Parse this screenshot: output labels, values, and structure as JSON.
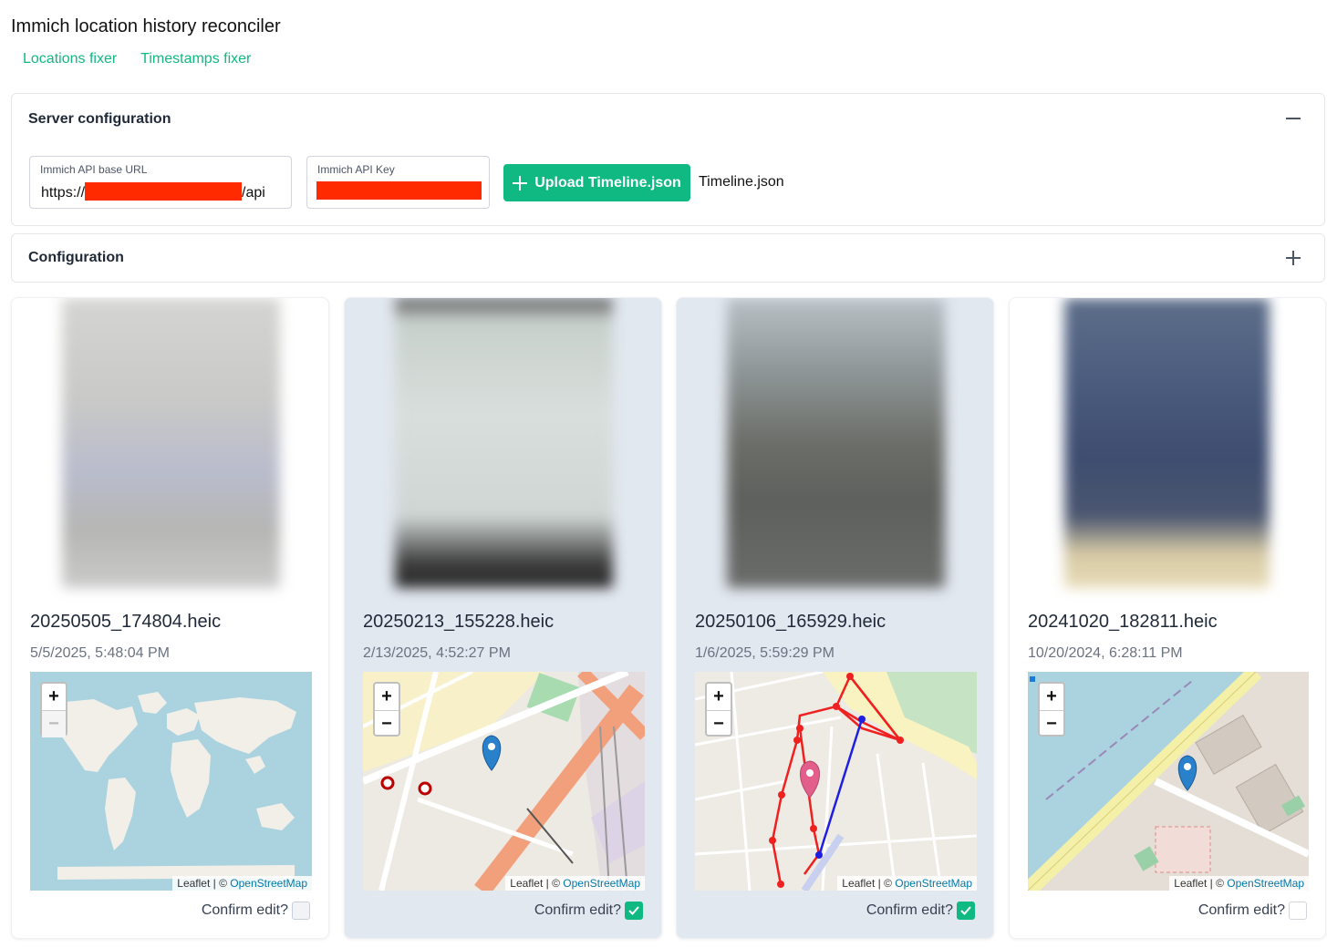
{
  "app": {
    "title": "Immich location history reconciler",
    "nav": [
      "Locations fixer",
      "Timestamps fixer"
    ]
  },
  "server_config": {
    "title": "Server configuration",
    "expanded": true,
    "api_url": {
      "label": "Immich API base URL",
      "prefix": "https://",
      "suffix": "/api"
    },
    "api_key": {
      "label": "Immich API Key"
    },
    "upload_label": "Upload Timeline.json",
    "uploaded_file": "Timeline.json"
  },
  "configuration": {
    "title": "Configuration",
    "expanded": false
  },
  "colors": {
    "accent": "#10b981",
    "redaction": "#ff2a00",
    "selected_card": "#e2e8f0",
    "route_red": "#ef2020",
    "route_blue": "#1f1fe0"
  },
  "cards": [
    {
      "filename": "20250505_174804.heic",
      "timestamp": "5/5/2025, 5:48:04 PM",
      "confirm_label": "Confirm edit?",
      "confirmed": false,
      "selected": false,
      "map": {
        "zoom_in": "+",
        "zoom_out": "−",
        "attribution": "Leaflet | ©",
        "osm": "OpenStreetMap"
      }
    },
    {
      "filename": "20250213_155228.heic",
      "timestamp": "2/13/2025, 4:52:27 PM",
      "confirm_label": "Confirm edit?",
      "confirmed": true,
      "selected": true,
      "map": {
        "zoom_in": "+",
        "zoom_out": "−",
        "attribution": "Leaflet | ©",
        "osm": "OpenStreetMap"
      }
    },
    {
      "filename": "20250106_165929.heic",
      "timestamp": "1/6/2025, 5:59:29 PM",
      "confirm_label": "Confirm edit?",
      "confirmed": true,
      "selected": true,
      "map": {
        "zoom_in": "+",
        "zoom_out": "−",
        "attribution": "Leaflet | ©",
        "osm": "OpenStreetMap"
      }
    },
    {
      "filename": "20241020_182811.heic",
      "timestamp": "10/20/2024, 6:28:11 PM",
      "confirm_label": "Confirm edit?",
      "confirmed": false,
      "selected": false,
      "map": {
        "zoom_in": "+",
        "zoom_out": "−",
        "attribution": "Leaflet | ©",
        "osm": "OpenStreetMap"
      }
    }
  ]
}
